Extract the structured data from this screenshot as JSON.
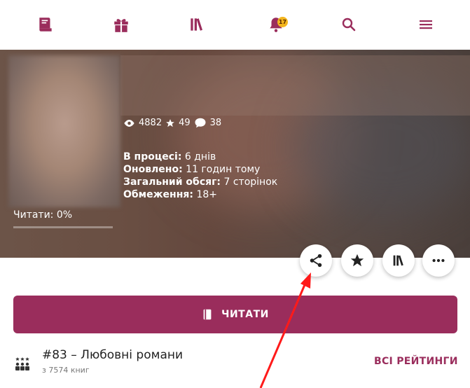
{
  "colors": {
    "accent": "#9a2d5c",
    "badge": "#f3b51e",
    "annotation_arrow": "#ff1a1a"
  },
  "nav": {
    "items": [
      {
        "name": "book-icon"
      },
      {
        "name": "gift-icon"
      },
      {
        "name": "library-icon"
      },
      {
        "name": "notifications-bell-icon",
        "badge": "17"
      },
      {
        "name": "search-icon"
      },
      {
        "name": "menu-icon"
      }
    ]
  },
  "book": {
    "stats": {
      "views": "4882",
      "stars": "49",
      "comments": "38"
    },
    "meta": [
      {
        "label": "В процесі:",
        "value": "6 днів"
      },
      {
        "label": "Оновлено:",
        "value": "11 годин тому"
      },
      {
        "label": "Загальний обсяг:",
        "value": "7 сторінок"
      },
      {
        "label": "Обмеження:",
        "value": "18+"
      }
    ],
    "read_progress_label": "Читати: 0%",
    "read_progress": 0.0
  },
  "actions": [
    {
      "name": "share-icon"
    },
    {
      "name": "star-icon"
    },
    {
      "name": "library-icon"
    },
    {
      "name": "more-icon"
    }
  ],
  "read_button": {
    "label": "ЧИТАТИ"
  },
  "ranking": {
    "title": "#83 – Любовні романи",
    "subtitle": "з 7574 книг",
    "all_ratings_label": "ВСІ РЕЙТИНГИ"
  }
}
